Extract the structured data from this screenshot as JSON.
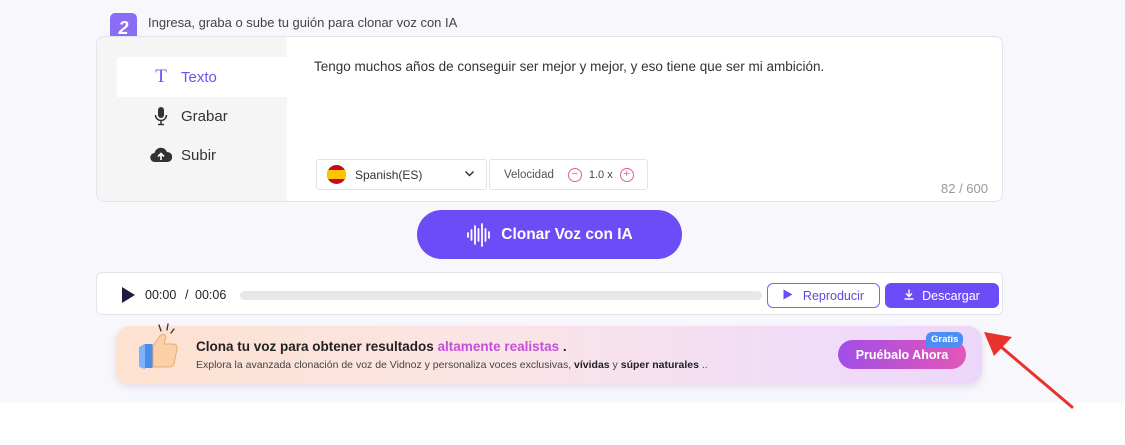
{
  "step": {
    "number": "2",
    "title": "Ingresa, graba o sube tu guión para clonar voz con IA"
  },
  "modes": [
    {
      "label": "Texto",
      "icon": "text-T-icon",
      "active": true
    },
    {
      "label": "Grabar",
      "icon": "microphone-icon",
      "active": false
    },
    {
      "label": "Subir",
      "icon": "cloud-upload-icon",
      "active": false
    }
  ],
  "editor": {
    "text": "Tengo muchos años de conseguir ser mejor y mejor, y eso tiene que ser mi ambición.",
    "language": "Spanish(ES)",
    "speed_label": "Velocidad",
    "speed_value": "1.0 x",
    "char_count": "82 / 600"
  },
  "clone_button": {
    "label": "Clonar Voz con IA"
  },
  "player": {
    "current_time": "00:00",
    "separator": "/",
    "total_time": "00:06",
    "progress": 0,
    "play_label": "Reproducir",
    "download_label": "Descargar"
  },
  "promo": {
    "title_prefix": "Clona tu voz para obtener resultados ",
    "title_highlight": "altamente realistas",
    "title_suffix": " .",
    "sub_prefix": "Explora la avanzada clonación de voz de Vidnoz y personaliza voces exclusivas, ",
    "sub_bold1": "vívidas",
    "sub_mid": " y ",
    "sub_bold2": "súper naturales",
    "sub_suffix": " ..",
    "button_label": "Pruébalo Ahora",
    "badge": "Gratis"
  },
  "colors": {
    "accent": "#6c4cf6",
    "badge_purple": "#8b6cf5",
    "highlight": "#c34fdc",
    "arrow_red": "#e8322c",
    "badge_blue": "#4b8ef6"
  }
}
